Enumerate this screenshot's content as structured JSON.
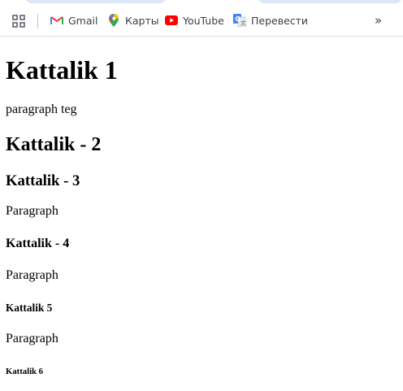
{
  "bookmarks": {
    "apps_icon": "grid-icon",
    "items": [
      {
        "label": "Gmail",
        "icon": "gmail-icon"
      },
      {
        "label": "Карты",
        "icon": "maps-pin-icon"
      },
      {
        "label": "YouTube",
        "icon": "youtube-icon"
      },
      {
        "label": "Перевести",
        "icon": "translate-icon"
      }
    ],
    "more_icon": "double-chevron-right-icon"
  },
  "page": {
    "h1": "Kattalik 1",
    "p1": "paragraph teg",
    "h2": "Kattalik - 2",
    "h3": "Kattalik - 3",
    "p2": "Paragraph",
    "h4": "Kattalik - 4",
    "p3": "Paragraph",
    "h5": "Kattalik 5",
    "p4": "Paragraph",
    "h6": "Kattalik 6"
  },
  "colors": {
    "tab_accent": "#dbe6f7",
    "bar_border": "#dadce0",
    "youtube_red": "#ff0000",
    "gmail_red": "#ea4335",
    "translate_blue": "#4285f4"
  }
}
